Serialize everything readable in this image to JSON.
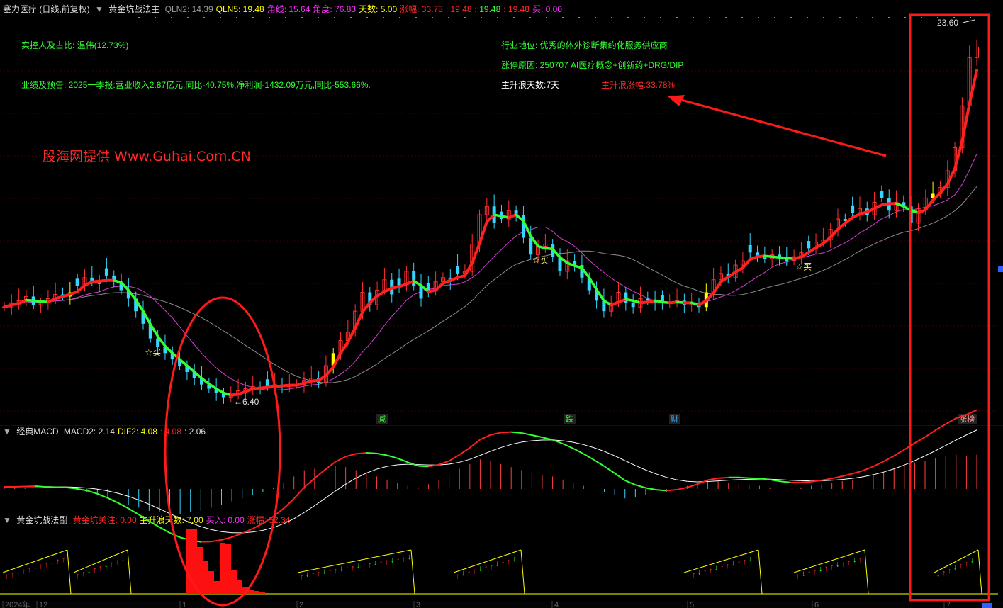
{
  "header": {
    "stock": "塞力医疗 (日线,前复权)",
    "indicator": "黄金坑战法主",
    "values": [
      {
        "label": "QLN2:",
        "value": "14.39",
        "color": "#9a9a9a"
      },
      {
        "label": "QLN5:",
        "value": "19.48",
        "color": "#ffff00"
      },
      {
        "label": "角线:",
        "value": "15.64",
        "color": "#ff33ff"
      },
      {
        "label": "角度:",
        "value": "76.83",
        "color": "#ff33ff"
      },
      {
        "label": "天数:",
        "value": "5.00",
        "color": "#ffff00"
      },
      {
        "label": "涨幅:",
        "value": "33.78",
        "color": "#ff2a2a"
      },
      {
        "label": ":",
        "value": "19.48",
        "color": "#ff2a2a"
      },
      {
        "label": ":",
        "value": "19.48",
        "color": "#33ff33"
      },
      {
        "label": ":",
        "value": "19.48",
        "color": "#ff2a2a"
      },
      {
        "label": "买:",
        "value": "0.00",
        "color": "#ff33ff"
      }
    ]
  },
  "annotations": {
    "controller": "实控人及占比: 温伟(12.73%)",
    "performance": "业绩及预告: 2025一季报:营业收入2.87亿元,同比-40.75%,净利润-1432.09万元,同比-553.66%.",
    "industry": "行业地位: 优秀的体外诊断集约化服务供应商",
    "limit_reason": "涨停原因: 250707 AI医疗概念+创新药+DRG/DIP",
    "wave_days": "主升浪天数:7天",
    "wave_gain": "主升浪涨幅:33.78%",
    "watermark": "股海网提供 Www.Guhai.Com.CN"
  },
  "macd_header": {
    "name": "经典MACD",
    "values": [
      {
        "label": "MACD2:",
        "value": "2.14",
        "color": "#dddddd"
      },
      {
        "label": "DIF2:",
        "value": "4.08",
        "color": "#ffff00"
      },
      {
        "label": ":",
        "value": "4.08",
        "color": "#ff2a2a"
      },
      {
        "label": ":",
        "value": "2.06",
        "color": "#dddddd"
      }
    ]
  },
  "sub_header": {
    "name": "黄金坑战法副",
    "values": [
      {
        "label": "黄金坑关注:",
        "value": "0.00",
        "color": "#ff2a2a"
      },
      {
        "label": "主升浪天数:",
        "value": "7.00",
        "color": "#ffff00"
      },
      {
        "label": "买入:",
        "value": "0.00",
        "color": "#ff33ff"
      },
      {
        "label": "涨幅:",
        "value": "52.34",
        "color": "#ff2a2a"
      }
    ]
  },
  "chart_data": {
    "type": "candlestick",
    "x_axis": [
      "2024年",
      "12",
      "1",
      "2",
      "3",
      "4",
      "5",
      "6",
      "7"
    ],
    "price_labels": {
      "high": "23.60",
      "low": "6.40"
    },
    "buy_label": "☆买",
    "events": [
      "减",
      "跌",
      "财",
      "涨榜"
    ],
    "closes": [
      10.8,
      11.0,
      11.1,
      11.3,
      10.9,
      11.0,
      11.2,
      11.4,
      11.3,
      11.5,
      11.8,
      12.2,
      12.0,
      11.9,
      12.3,
      12.0,
      11.6,
      11.2,
      10.6,
      10.0,
      9.3,
      8.9,
      8.6,
      8.3,
      8.0,
      7.7,
      7.4,
      7.1,
      6.9,
      6.7,
      6.5,
      6.6,
      6.8,
      6.9,
      7.0,
      6.9,
      7.0,
      7.1,
      7.0,
      7.1,
      7.1,
      7.3,
      7.4,
      7.2,
      8.0,
      8.6,
      9.2,
      9.6,
      10.6,
      11.5,
      10.9,
      11.6,
      12.1,
      11.4,
      11.8,
      12.5,
      11.8,
      11.2,
      11.6,
      12.0,
      12.2,
      12.0,
      12.4,
      12.5,
      13.8,
      15.2,
      15.6,
      14.8,
      15.0,
      15.4,
      15.2,
      14.1,
      13.3,
      13.7,
      13.8,
      13.2,
      12.5,
      13.0,
      12.8,
      12.2,
      11.6,
      11.1,
      10.6,
      11.0,
      11.5,
      11.0,
      10.8,
      11.2,
      11.1,
      11.0,
      11.0,
      11.0,
      11.1,
      10.9,
      11.0,
      10.8,
      11.5,
      12.1,
      12.4,
      12.2,
      12.8,
      13.0,
      13.4,
      13.2,
      13.1,
      13.3,
      13.1,
      13.0,
      13.2,
      13.4,
      13.6,
      13.9,
      14.0,
      14.5,
      15.0,
      14.9,
      15.3,
      15.5,
      15.2,
      15.8,
      16.0,
      15.4,
      15.8,
      15.6,
      14.8,
      15.5,
      16.0,
      16.2,
      16.5,
      17.3,
      18.4,
      20.4,
      22.7,
      23.2
    ],
    "marker_gain": 0.08,
    "down_sel_idx": [
      10,
      12,
      14,
      16,
      22,
      30,
      36,
      54,
      58,
      62,
      68,
      72,
      80,
      86,
      90,
      102,
      110,
      116,
      120
    ],
    "yellow_idx": [
      9,
      45,
      96,
      127
    ],
    "macd_bars": [
      0.2,
      0.1,
      0.1,
      0.1,
      0.0,
      0.0,
      0.0,
      -0.1,
      -0.2,
      -0.4,
      -0.6,
      -0.8,
      -1.0,
      -1.2,
      -1.4,
      -1.5,
      -1.6,
      -1.6,
      -1.5,
      -1.4,
      -1.2,
      -1.0,
      -0.8,
      -0.6,
      -0.4,
      -0.2,
      0.1,
      0.4,
      0.8,
      1.2,
      1.3,
      1.4,
      1.5,
      1.4,
      1.2,
      1.0,
      0.8,
      0.6,
      0.4,
      0.2,
      0.1,
      0.3,
      0.6,
      0.9,
      1.3,
      1.6,
      1.9,
      1.8,
      1.6,
      1.4,
      1.2,
      1.0,
      0.9,
      0.8,
      0.6,
      0.4,
      0.2,
      0.0,
      -0.2,
      -0.4,
      -0.6,
      -0.5,
      -0.4,
      -0.3,
      -0.2,
      0.0,
      0.2,
      0.4,
      0.6,
      0.5,
      0.4,
      0.3,
      0.2,
      0.2,
      0.1,
      0.0,
      0.0,
      0.1,
      0.2,
      0.3,
      0.4,
      0.5,
      0.6,
      0.7,
      0.9,
      1.1,
      1.3,
      1.5,
      1.7,
      1.8,
      2.0,
      2.1,
      2.2,
      2.1,
      2.2
    ]
  }
}
